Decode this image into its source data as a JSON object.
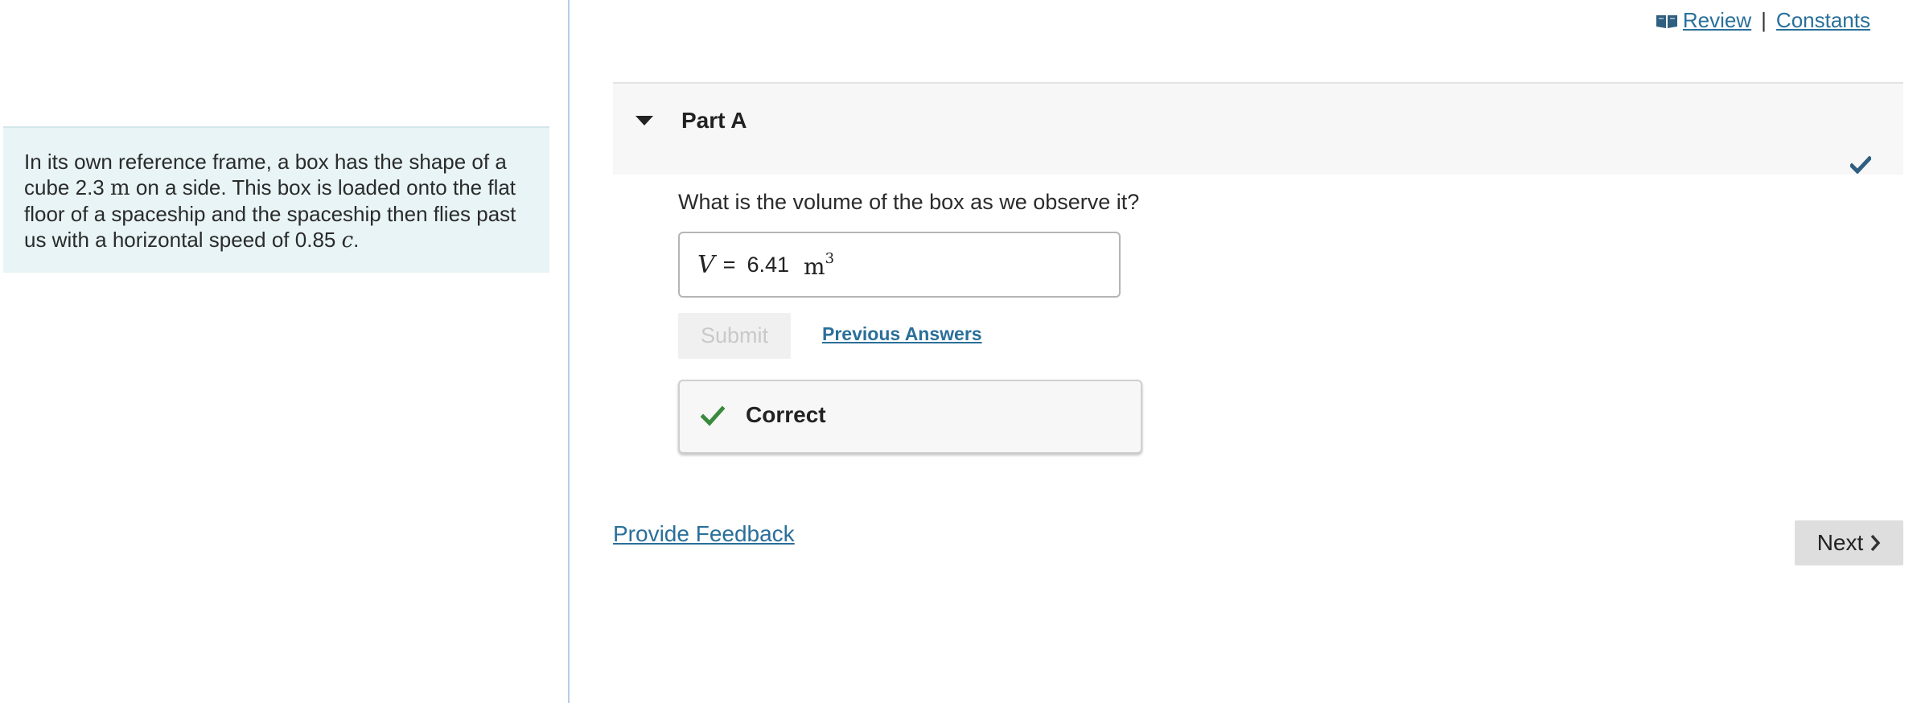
{
  "top_links": {
    "review_label": "Review",
    "separator": "|",
    "constants_label": "Constants"
  },
  "problem": {
    "text_1": "In its own reference frame, a box has the shape of a cube 2.3 ",
    "unit_m": "m",
    "text_2": " on a side. This box is loaded onto the flat floor of a spaceship and the spaceship then flies past us with a horizontal speed of 0.85 ",
    "var_c": "c",
    "text_3": "."
  },
  "part": {
    "title": "Part A",
    "question": "What is the volume of the box as we observe it?",
    "answer": {
      "variable": "V",
      "equals": "=",
      "value": "6.41",
      "unit": "m",
      "unit_exponent": "3"
    },
    "submit_label": "Submit",
    "previous_answers_label": "Previous Answers",
    "result_label": "Correct"
  },
  "footer": {
    "feedback_label": "Provide Feedback",
    "next_label": "Next"
  },
  "colors": {
    "link": "#2a6f9a",
    "correct_green": "#3a8a3e",
    "header_check": "#2f5f80",
    "problem_bg": "#e8f4f6"
  },
  "icons": {
    "review": "book-icon",
    "collapse": "caret-down-icon",
    "header_status": "check-icon",
    "result": "check-icon",
    "next": "chevron-right-icon"
  }
}
